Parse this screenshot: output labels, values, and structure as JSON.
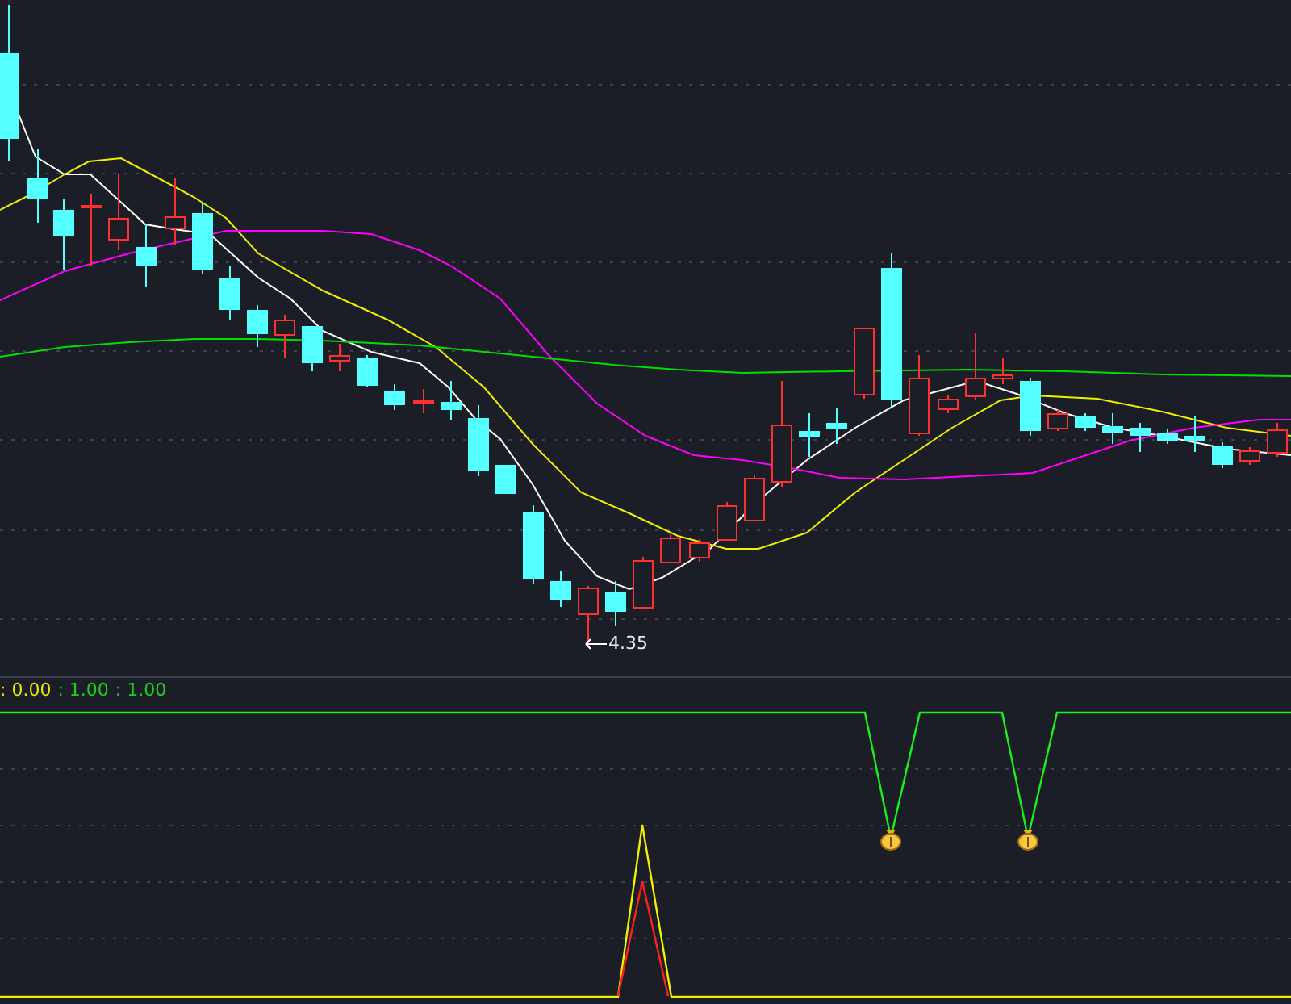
{
  "main_chart": {
    "low_marker": "4.35"
  },
  "indicator_panel": {
    "readouts": [
      {
        "text": ": 0.00",
        "color": "#e6e600"
      },
      {
        "text": ": 1.00",
        "color": "#1ccf1c"
      },
      {
        "text": ": 1.00",
        "color": "#1ccf1c"
      }
    ]
  }
}
